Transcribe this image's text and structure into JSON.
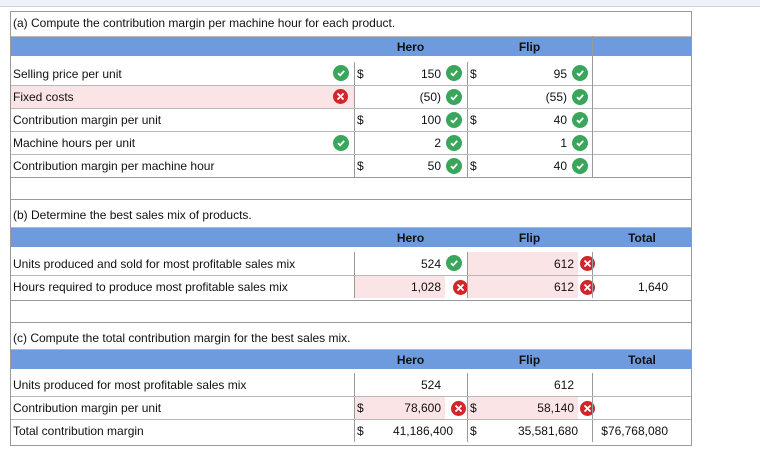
{
  "a": {
    "title": "(a) Compute the contribution margin per machine hour for each product.",
    "headers": {
      "hero": "Hero",
      "flip": "Flip"
    },
    "rows": [
      {
        "label": "Selling price per unit",
        "hero_cur": "$",
        "hero": "150",
        "flip_cur": "$",
        "flip": "95"
      },
      {
        "label": "Fixed costs",
        "hero_cur": "",
        "hero": "(50)",
        "flip_cur": "",
        "flip": "(55)"
      },
      {
        "label": "Contribution margin per unit",
        "hero_cur": "$",
        "hero": "100",
        "flip_cur": "$",
        "flip": "40"
      },
      {
        "label": "Machine hours per unit",
        "hero_cur": "",
        "hero": "2",
        "flip_cur": "",
        "flip": "1"
      },
      {
        "label": "Contribution margin per machine hour",
        "hero_cur": "$",
        "hero": "50",
        "flip_cur": "$",
        "flip": "40"
      }
    ]
  },
  "b": {
    "title": "(b) Determine the best sales mix of products.",
    "headers": {
      "hero": "Hero",
      "flip": "Flip",
      "total": "Total"
    },
    "rows": [
      {
        "label": "Units produced and sold for most profitable sales mix",
        "hero": "524",
        "flip": "612",
        "total": ""
      },
      {
        "label": "Hours required to produce most profitable sales mix",
        "hero": "1,028",
        "flip": "612",
        "total": "1,640"
      }
    ]
  },
  "c": {
    "title": "(c) Compute the total contribution margin for the best sales mix.",
    "headers": {
      "hero": "Hero",
      "flip": "Flip",
      "total": "Total"
    },
    "rows": [
      {
        "label": "Units produced for most profitable sales mix",
        "hero_cur": "",
        "hero": "524",
        "flip_cur": "",
        "flip": "612",
        "total": ""
      },
      {
        "label": "Contribution margin per unit",
        "hero_cur": "$",
        "hero": "78,600",
        "flip_cur": "$",
        "flip": "58,140",
        "total": ""
      },
      {
        "label": "Total contribution margin",
        "hero_cur": "$",
        "hero": "41,186,400",
        "flip_cur": "$",
        "flip": "35,581,680",
        "total": "$76,768,080"
      }
    ]
  },
  "colors": {
    "header": "#6d9bde",
    "correct": "#3aa65c",
    "incorrect": "#d2262a",
    "incorrect_bg": "#fbe4e6"
  }
}
